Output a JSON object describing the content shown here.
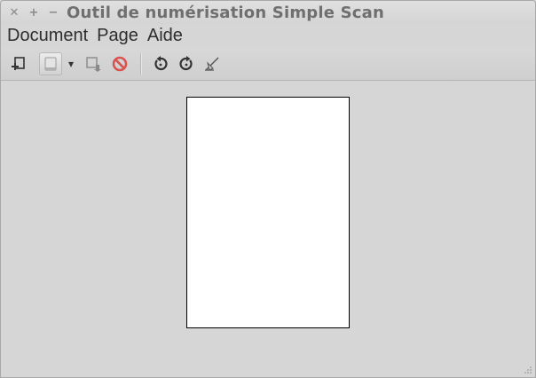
{
  "window": {
    "title": "Outil de numérisation Simple Scan",
    "controls": {
      "close": "✕",
      "maximize": "+",
      "minimize": "−"
    }
  },
  "menubar": {
    "items": [
      {
        "label": "Document"
      },
      {
        "label": "Page"
      },
      {
        "label": "Aide"
      }
    ]
  },
  "toolbar": {
    "buttons": [
      {
        "icon": "new-document-icon"
      },
      {
        "icon": "scan-icon"
      },
      {
        "icon": "dropdown-arrow-icon",
        "glyph": "▾"
      },
      {
        "icon": "save-icon"
      },
      {
        "icon": "stop-icon"
      },
      {
        "icon": "rotate-left-icon"
      },
      {
        "icon": "rotate-right-icon"
      },
      {
        "icon": "crop-icon"
      }
    ]
  },
  "colors": {
    "window_bg": "#d6d6d6",
    "title_text": "#6f6f6f",
    "stop_red": "#d9534f",
    "page_bg": "#ffffff"
  }
}
